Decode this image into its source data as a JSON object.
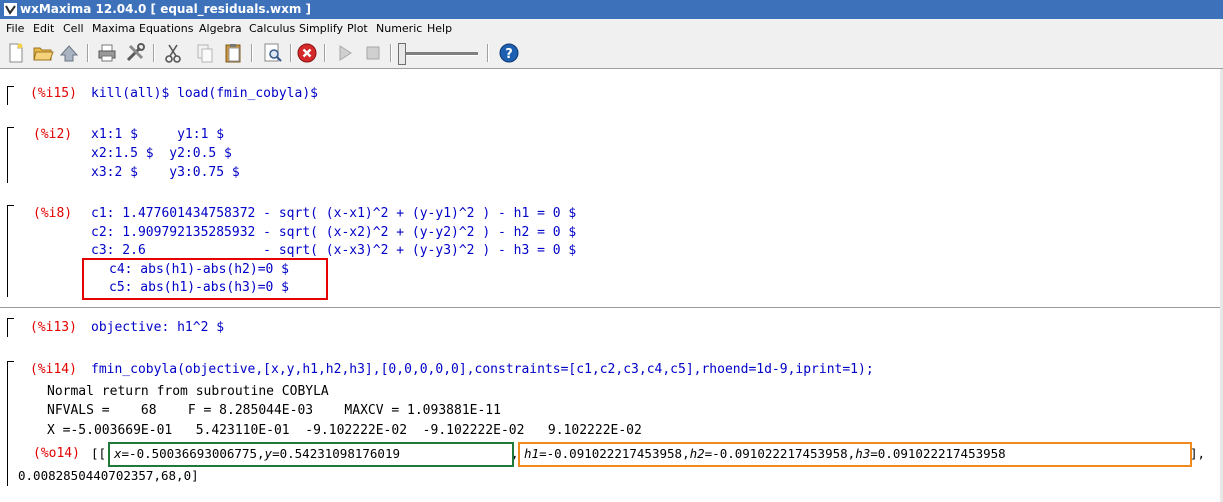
{
  "window": {
    "title": "wxMaxima 12.04.0  [ equal_residuals.wxm ]"
  },
  "menu": [
    "File",
    "Edit",
    "Cell",
    "Maxima",
    "Equations",
    "Algebra",
    "Calculus",
    "Simplify",
    "Plot",
    "Numeric",
    "Help"
  ],
  "toolbar": {
    "buttons": [
      "new-icon",
      "open-icon",
      "save-icon",
      "print-icon",
      "preferences-icon",
      "cut-icon",
      "copy-icon",
      "paste-icon",
      "find-icon",
      "interrupt-icon",
      "play-icon",
      "stop-icon",
      "help-icon"
    ],
    "colors": {
      "interrupt": "#d42a2a",
      "help": "#1d5fb0"
    }
  },
  "cells": {
    "c1": {
      "label": "(%i15)",
      "lines": [
        "kill(all)$ load(fmin_cobyla)$"
      ]
    },
    "c2": {
      "label": "(%i2)",
      "lines": [
        "x1:1 $     y1:1 $",
        "x2:1.5 $  y2:0.5 $",
        "x3:2 $    y3:0.75 $"
      ]
    },
    "c3": {
      "label": "(%i8)",
      "lines": [
        "c1: 1.477601434758372 - sqrt( (x-x1)^2 + (y-y1)^2 ) - h1 = 0 $",
        "c2: 1.909792135285932 - sqrt( (x-x2)^2 + (y-y2)^2 ) - h2 = 0 $",
        "c3: 2.6               - sqrt( (x-x3)^2 + (y-y3)^2 ) - h3 = 0 $",
        "c4: abs(h1)-abs(h2)=0 $",
        "c5: abs(h1)-abs(h3)=0 $"
      ]
    },
    "c4": {
      "label": "(%i13)",
      "lines": [
        "objective: h1^2 $"
      ]
    },
    "c5": {
      "label": "(%i14)",
      "lines": [
        "fmin_cobyla(objective,[x,y,h1,h2,h3],[0,0,0,0,0],constraints=[c1,c2,c3,c4,c5],rhoend=1d-9,iprint=1);"
      ],
      "printed": [
        "Normal return from subroutine COBYLA",
        "NFVALS =    68    F = 8.285044E-03    MAXCV = 1.093881E-11",
        "X =-5.003669E-01   5.423110E-01  -9.102222E-02  -9.102222E-02   9.102222E-02"
      ],
      "output": {
        "label": "(%o14)",
        "open": "[[",
        "xy": "x=-0.50036693006775,y=0.54231098176019",
        "comma": ",",
        "h": "h1=-0.091022217453958,h2=-0.091022217453958,h3=0.091022217453958",
        "close": "],",
        "line2": "0.0082850440702357,68,0]"
      }
    }
  },
  "highlights": {
    "red": "#e60000",
    "green": "#1f7a3a",
    "orange": "#f08a1c"
  }
}
